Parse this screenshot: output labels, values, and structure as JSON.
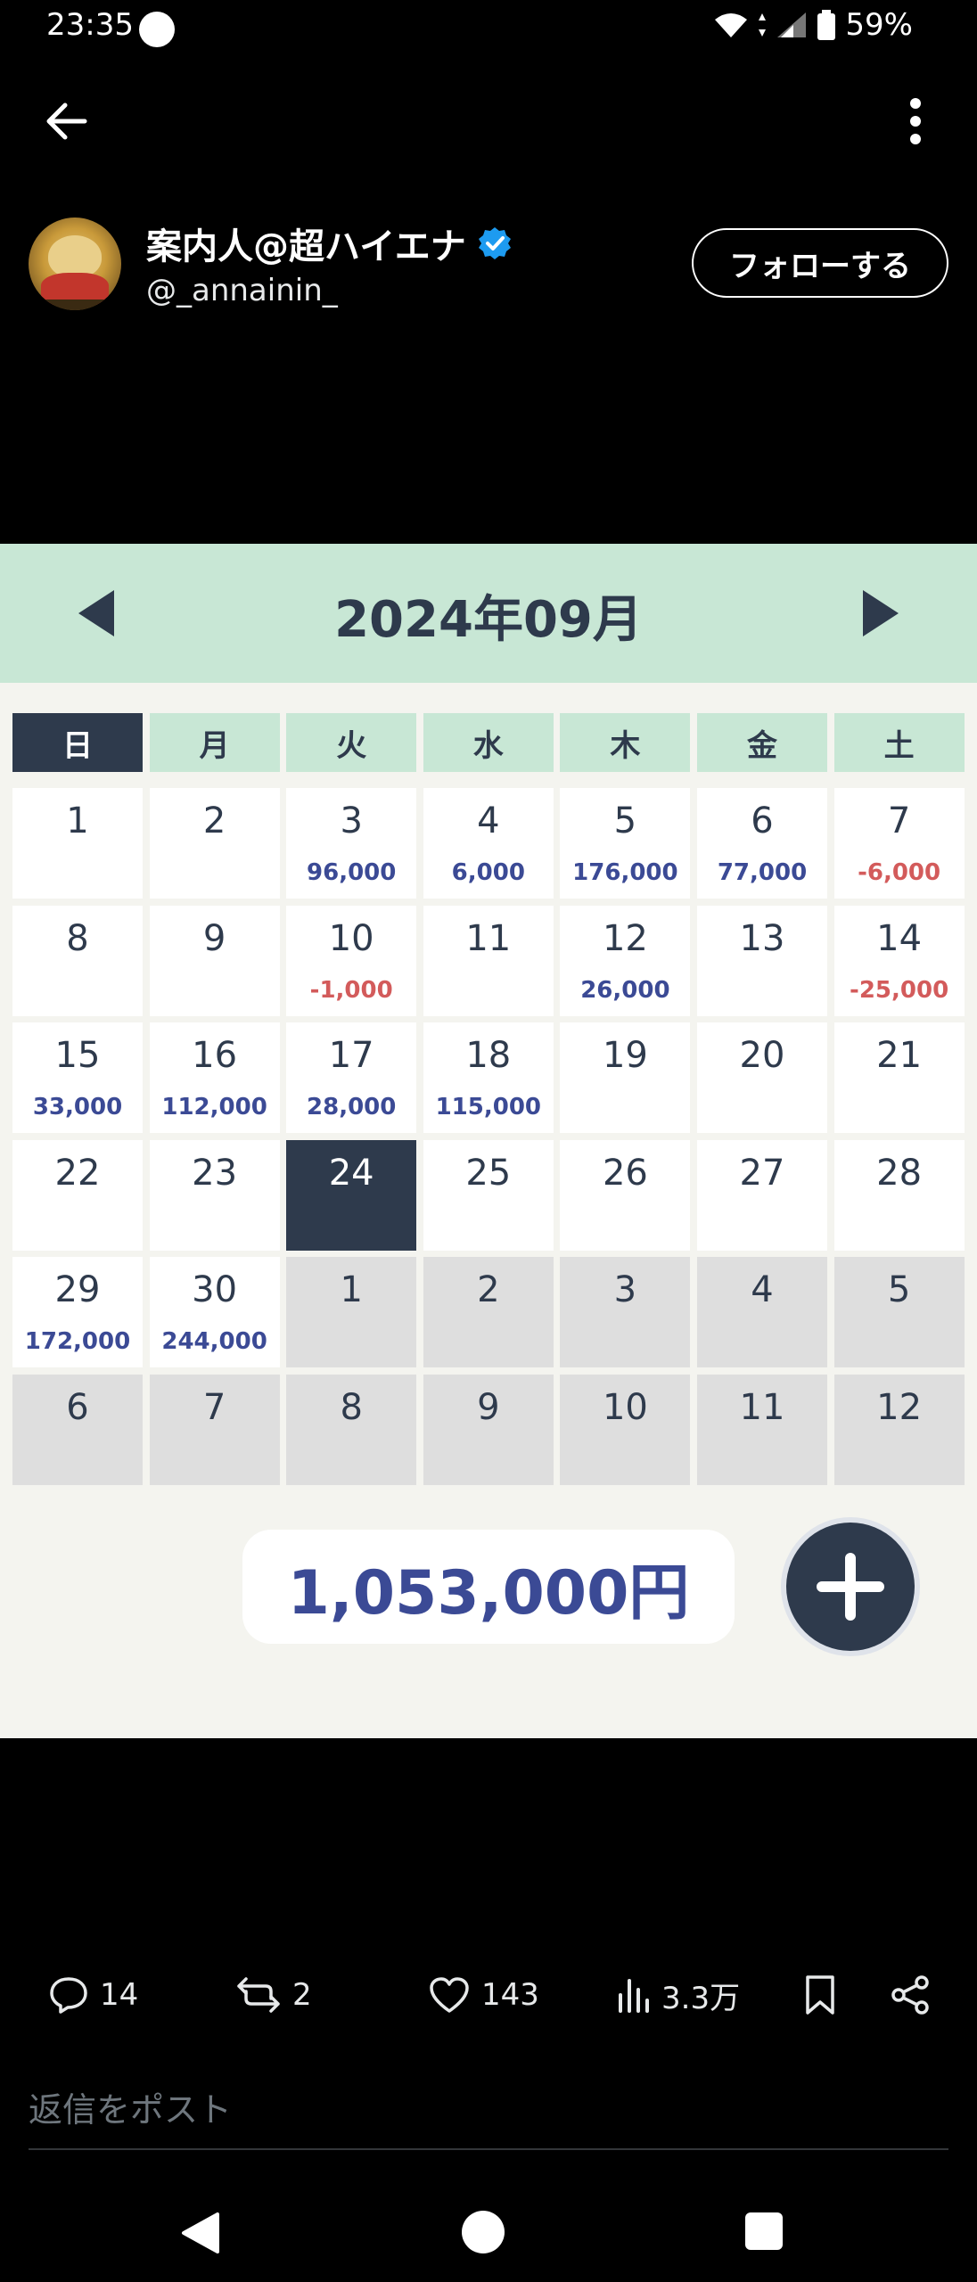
{
  "status_bar": {
    "time": "23:35",
    "battery": "59%"
  },
  "profile": {
    "display_name": "案内人@超ハイエナ",
    "handle": "@_annainin_",
    "follow_label": "フォローする"
  },
  "calendar": {
    "month_title": "2024年09月",
    "weekdays": [
      "日",
      "月",
      "火",
      "水",
      "木",
      "金",
      "土"
    ],
    "weeks": [
      [
        {
          "day": "1",
          "amount": ""
        },
        {
          "day": "2",
          "amount": ""
        },
        {
          "day": "3",
          "amount": "96,000"
        },
        {
          "day": "4",
          "amount": "6,000"
        },
        {
          "day": "5",
          "amount": "176,000"
        },
        {
          "day": "6",
          "amount": "77,000"
        },
        {
          "day": "7",
          "amount": "-6,000"
        }
      ],
      [
        {
          "day": "8",
          "amount": ""
        },
        {
          "day": "9",
          "amount": ""
        },
        {
          "day": "10",
          "amount": "-1,000"
        },
        {
          "day": "11",
          "amount": ""
        },
        {
          "day": "12",
          "amount": "26,000"
        },
        {
          "day": "13",
          "amount": ""
        },
        {
          "day": "14",
          "amount": "-25,000"
        }
      ],
      [
        {
          "day": "15",
          "amount": "33,000"
        },
        {
          "day": "16",
          "amount": "112,000"
        },
        {
          "day": "17",
          "amount": "28,000"
        },
        {
          "day": "18",
          "amount": "115,000"
        },
        {
          "day": "19",
          "amount": ""
        },
        {
          "day": "20",
          "amount": ""
        },
        {
          "day": "21",
          "amount": ""
        }
      ],
      [
        {
          "day": "22",
          "amount": ""
        },
        {
          "day": "23",
          "amount": ""
        },
        {
          "day": "24",
          "amount": "",
          "today": true
        },
        {
          "day": "25",
          "amount": ""
        },
        {
          "day": "26",
          "amount": ""
        },
        {
          "day": "27",
          "amount": ""
        },
        {
          "day": "28",
          "amount": ""
        }
      ],
      [
        {
          "day": "29",
          "amount": "172,000"
        },
        {
          "day": "30",
          "amount": "244,000"
        },
        {
          "day": "1",
          "amount": "",
          "other": true
        },
        {
          "day": "2",
          "amount": "",
          "other": true
        },
        {
          "day": "3",
          "amount": "",
          "other": true
        },
        {
          "day": "4",
          "amount": "",
          "other": true
        },
        {
          "day": "5",
          "amount": "",
          "other": true
        }
      ],
      [
        {
          "day": "6",
          "amount": "",
          "other": true
        },
        {
          "day": "7",
          "amount": "",
          "other": true
        },
        {
          "day": "8",
          "amount": "",
          "other": true
        },
        {
          "day": "9",
          "amount": "",
          "other": true
        },
        {
          "day": "10",
          "amount": "",
          "other": true
        },
        {
          "day": "11",
          "amount": "",
          "other": true
        },
        {
          "day": "12",
          "amount": "",
          "other": true
        }
      ]
    ],
    "total": "1,053,000円"
  },
  "actions": {
    "replies": "14",
    "reposts": "2",
    "likes": "143",
    "views": "3.3万"
  },
  "reply_placeholder": "返信をポスト",
  "colors": {
    "calendar_header": "#c8e7d5",
    "calendar_dark": "#2e3a4c",
    "positive_amount": "#3b4a95",
    "negative_amount": "#d35b5b",
    "other_month_cell": "#dedede"
  }
}
